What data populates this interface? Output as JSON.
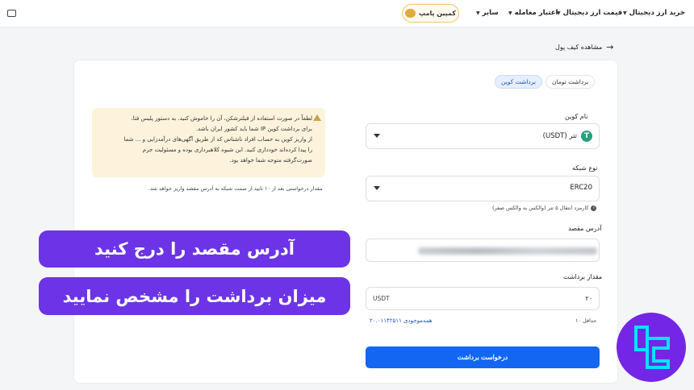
{
  "nav": {
    "items": [
      "خرید ارز دیجیتال",
      "قیمت ارز دیجیتال",
      "اعتبار معامله",
      "سایر"
    ],
    "campaign": "کمپین پامپ"
  },
  "back_link": "مشاهده کیف پول",
  "tabs": [
    {
      "label": "برداشت تومان",
      "active": false
    },
    {
      "label": "برداشت کوین",
      "active": true
    }
  ],
  "form": {
    "coin_label": "نام کوین",
    "coin_value": "تتر (USDT)",
    "network_label": "نوع شبکه",
    "network_value": "ERC20",
    "fee_hint": "کارمزد انتقال ۵ تتر (والکس به والکس صفر)",
    "address_label": "آدرس مقصد",
    "amount_label": "مقدار برداشت",
    "amount_unit": "USDT",
    "amount_value": "۲۰",
    "min_label": "حداقل ۱۰",
    "balance_label": "همه‌موجودی ۲۰.۰۱۱۴۲۵۱۱",
    "submit": "درخواست برداشت"
  },
  "warning": {
    "lines": [
      "لطفاً در صورت استفاده از فیلترشکن، آن را خاموش کنید. به دستور پلیس فتا،",
      "برای برداشت کوین IP شما باید کشور ایران باشد.",
      "از واریز کوین به حساب افراد ناشناس که از طریق آگهی‌های درآمدزایی و ... شما",
      "را پیدا کرده‌اند خودداری کنید. این شیوه کلاهبرداری بوده و مسئولیت جرم",
      "صورت‌گرفته متوجه شما خواهد بود."
    ]
  },
  "note": "مقدار درخواستی بعد از ۱۰ تایید از سمت شبکه به آدرس مقصد واریز خواهد شد.",
  "banners": {
    "first": "آدرس مقصد را درج کنید",
    "second": "میزان برداشت را مشخص نمایید"
  },
  "colors": {
    "primary": "#1266f1",
    "banner": "#6c34e6",
    "warning_bg": "#fdf3dc",
    "tether": "#26a17b",
    "logo_bg": "#7426e6",
    "logo_fg": "#00e5ff"
  }
}
